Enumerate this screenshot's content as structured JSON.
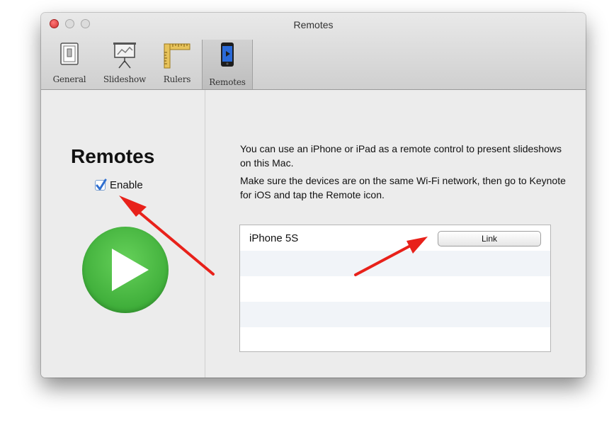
{
  "window": {
    "title": "Remotes"
  },
  "toolbar": {
    "items": [
      {
        "label": "General",
        "icon": "general-icon"
      },
      {
        "label": "Slideshow",
        "icon": "slideshow-icon"
      },
      {
        "label": "Rulers",
        "icon": "rulers-icon"
      },
      {
        "label": "Remotes",
        "icon": "remotes-icon",
        "selected": true
      }
    ]
  },
  "left_panel": {
    "heading": "Remotes",
    "enable_label": "Enable",
    "enable_checked": true,
    "play_icon": "play-icon"
  },
  "right_panel": {
    "description_1": "You can use an iPhone or iPad as a remote control to present slideshows on this Mac.",
    "description_2": "Make sure the devices are on the same Wi-Fi network, then go to Keynote for iOS and tap the Remote icon.",
    "devices": [
      {
        "name": "iPhone 5S",
        "action_label": "Link"
      }
    ]
  },
  "colors": {
    "close_button": "#e0443e",
    "play_green": "#4cbb43",
    "checkbox_blue": "#2f6fd0",
    "annotation_red": "#e8211a"
  }
}
